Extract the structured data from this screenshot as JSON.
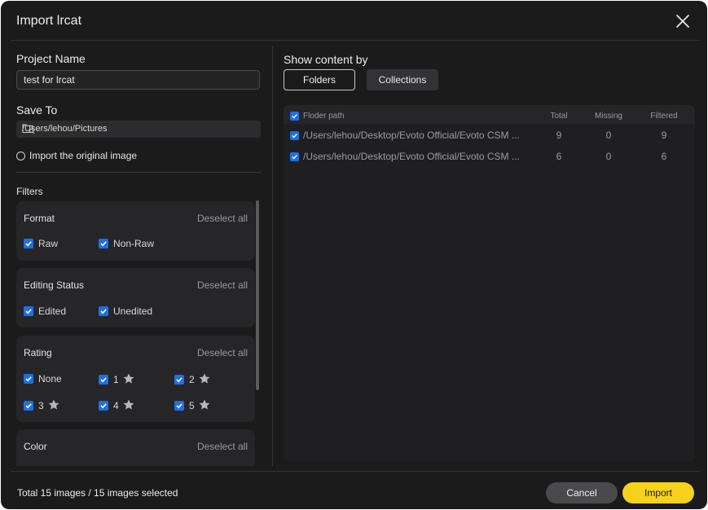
{
  "window": {
    "title": "Import lrcat"
  },
  "left": {
    "project_label": "Project Name",
    "project_value": "test for lrcat",
    "save_label": "Save To",
    "save_path": "/Users/lehou/Pictures",
    "import_original_label": "Import the original image",
    "filters_label": "Filters"
  },
  "filters": {
    "format": {
      "title": "Format",
      "deselect": "Deselect all",
      "options": [
        "Raw",
        "Non-Raw"
      ]
    },
    "editing": {
      "title": "Editing Status",
      "deselect": "Deselect all",
      "options": [
        "Edited",
        "Unedited"
      ]
    },
    "rating": {
      "title": "Rating",
      "deselect": "Deselect all",
      "options": [
        "None",
        "1",
        "2",
        "3",
        "4",
        "5"
      ]
    },
    "color": {
      "title": "Color",
      "deselect": "Deselect all"
    }
  },
  "right": {
    "show_label": "Show content by",
    "tabs": [
      "Folders",
      "Collections"
    ],
    "active_tab": "Folders",
    "columns": {
      "path": "Floder path",
      "total": "Total",
      "missing": "Missing",
      "filtered": "Filtered"
    },
    "rows": [
      {
        "path": "/Users/lehou/Desktop/Evoto Official/Evoto CSM ...",
        "total": "9",
        "missing": "0",
        "filtered": "9"
      },
      {
        "path": "/Users/lehou/Desktop/Evoto Official/Evoto CSM ...",
        "total": "6",
        "missing": "0",
        "filtered": "6"
      }
    ]
  },
  "footer": {
    "summary": "Total 15 images / 15 images selected",
    "cancel": "Cancel",
    "import": "Import"
  },
  "colors": {
    "accent": "#1e6fe8",
    "import_button": "#f7d21c",
    "background": "#1b1b1c"
  },
  "icons": [
    "close-icon",
    "folder-search-icon",
    "checkmark-icon",
    "star-icon"
  ]
}
